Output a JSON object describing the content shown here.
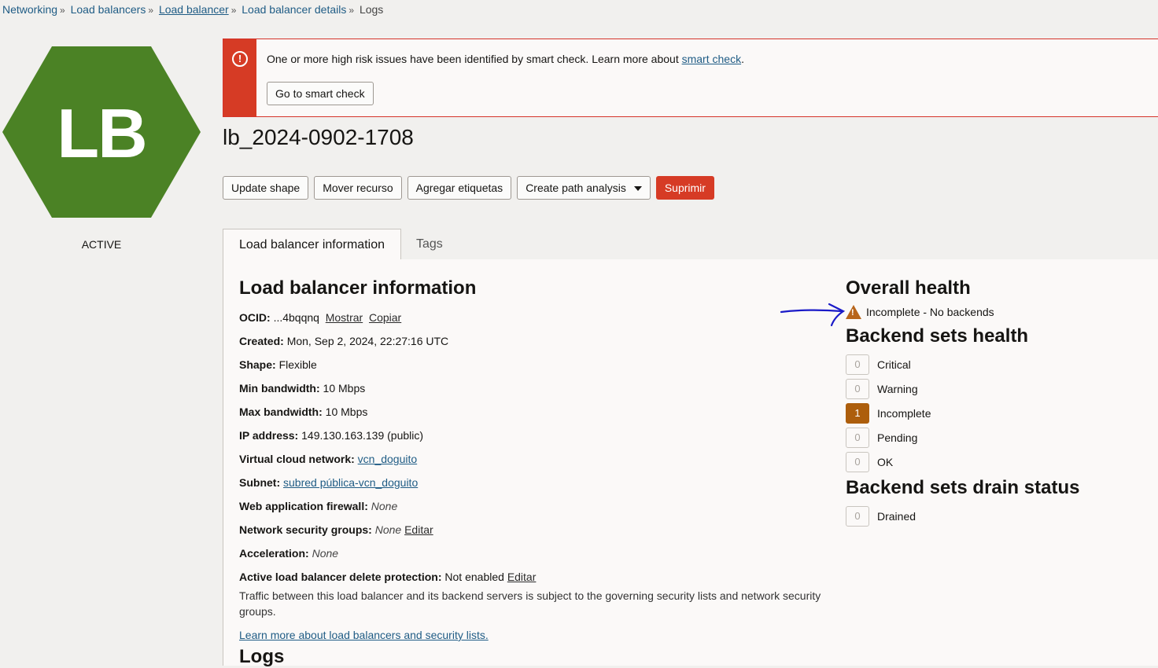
{
  "breadcrumb": {
    "items": [
      "Networking",
      "Load balancers",
      "Load balancer",
      "Load balancer details"
    ],
    "current": "Logs"
  },
  "logo": {
    "letters": "LB",
    "color": "#4b8225"
  },
  "state": "ACTIVE",
  "alert": {
    "message": "One or more high risk issues have been identified by smart check. Learn more about ",
    "link": "smart check",
    "suffix": ".",
    "button": "Go to smart check",
    "color": "#d63b25"
  },
  "title": "lb_2024-0902-1708",
  "actions": {
    "update_shape": "Update shape",
    "move": "Mover recurso",
    "tags": "Agregar etiquetas",
    "path_analysis": "Create path analysis",
    "delete": "Suprimir"
  },
  "tabs": [
    "Load balancer information",
    "Tags"
  ],
  "info": {
    "heading": "Load balancer information",
    "ocid": {
      "label": "OCID:",
      "value": "...4bqqnq",
      "show": "Mostrar",
      "copy": "Copiar"
    },
    "created": {
      "label": "Created:",
      "value": "Mon, Sep 2, 2024, 22:27:16 UTC"
    },
    "shape": {
      "label": "Shape:",
      "value": "Flexible"
    },
    "min_bw": {
      "label": "Min bandwidth:",
      "value": "10 Mbps"
    },
    "max_bw": {
      "label": "Max bandwidth:",
      "value": "10 Mbps"
    },
    "ip": {
      "label": "IP address:",
      "value": "149.130.163.139 (public)"
    },
    "vcn": {
      "label": "Virtual cloud network:",
      "value": "vcn_doguito"
    },
    "subnet": {
      "label": "Subnet:",
      "value": "subred pública-vcn_doguito"
    },
    "waf": {
      "label": "Web application firewall:",
      "value": "None"
    },
    "nsg": {
      "label": "Network security groups:",
      "value": "None",
      "edit": "Editar"
    },
    "accel": {
      "label": "Acceleration:",
      "value": "None"
    },
    "delete_protection": {
      "label": "Active load balancer delete protection:",
      "value": "Not enabled",
      "edit": "Editar"
    },
    "note": "Traffic between this load balancer and its backend servers is subject to the governing security lists and network security groups.",
    "learn_link": "Learn more about load balancers and security lists."
  },
  "logs_heading": "Logs",
  "health": {
    "overall_heading": "Overall health",
    "overall_status": "Incomplete - No backends",
    "status_color": "#b8651b",
    "backend_heading": "Backend sets health",
    "stats": [
      {
        "count": "0",
        "label": "Critical"
      },
      {
        "count": "0",
        "label": "Warning"
      },
      {
        "count": "1",
        "label": "Incomplete"
      },
      {
        "count": "0",
        "label": "Pending"
      },
      {
        "count": "0",
        "label": "OK"
      }
    ],
    "drain_heading": "Backend sets drain status",
    "drain": {
      "count": "0",
      "label": "Drained"
    }
  },
  "annotation": {
    "icon": "hand-drawn-arrow-icon",
    "color": "#1a1ac8"
  }
}
